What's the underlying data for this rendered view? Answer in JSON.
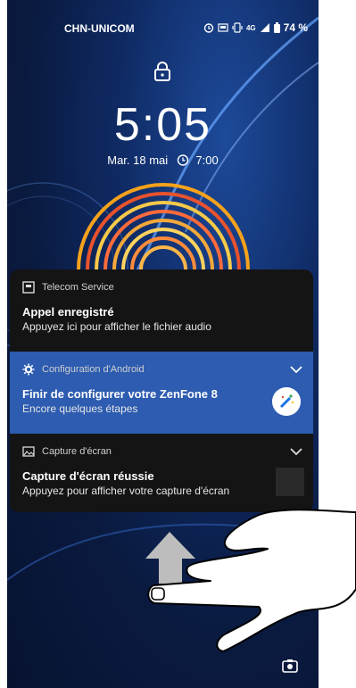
{
  "status_bar": {
    "carrier": "CHN-UNICOM",
    "network": "4G",
    "battery": "74 %"
  },
  "lock_screen": {
    "time": "5:05",
    "date": "Mar. 18 mai",
    "alarm": "7:00"
  },
  "notifications": [
    {
      "app": "Telecom Service",
      "title": "Appel enregistré",
      "body": "Appuyez ici pour afficher le fichier audio"
    },
    {
      "app": "Configuration d'Android",
      "title": "Finir de configurer votre ZenFone 8",
      "body": "Encore quelques étapes"
    },
    {
      "app": "Capture d'écran",
      "title": "Capture d'écran réussie",
      "body": "Appuyez pour afficher votre capture d'écran"
    }
  ],
  "colors": {
    "setup_card": "#2d5cb0",
    "card_dark": "#141414",
    "wallpaper_accent": "#f6a21b"
  },
  "icons": [
    "alarm-icon",
    "screenshot-status-icon",
    "vibrate-icon",
    "signal-icon",
    "battery-icon",
    "lock-icon",
    "camera-icon"
  ]
}
